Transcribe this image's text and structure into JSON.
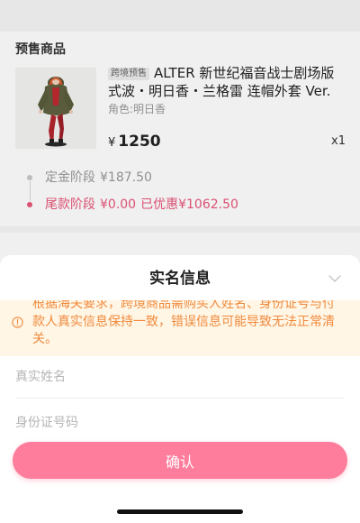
{
  "presale_section": {
    "title": "预售商品"
  },
  "product": {
    "tag": "跨境预售",
    "title": "ALTER 新世纪福音战士剧场版式波・明日香・兰格雷 连帽外套 Ver.",
    "attribute": "角色:明日香",
    "currency": "¥",
    "price": "1250",
    "quantity": "x1"
  },
  "payment_stages": [
    {
      "label": "定金阶段",
      "amount": "¥187.50"
    },
    {
      "label": "尾款阶段",
      "amount": "¥0.00",
      "discount": "已优惠¥1062.50"
    }
  ],
  "real_name_sheet": {
    "title": "实名信息",
    "notice": "根据海关要求，跨境商品需购买人姓名、身份证号与付款人真实信息保持一致，错误信息可能导致无法正常清关。",
    "name_field": {
      "placeholder": "真实姓名",
      "value": ""
    },
    "id_field": {
      "placeholder": "身份证号码",
      "value": ""
    },
    "confirm_label": "确认"
  },
  "icons": {
    "collapse": "chevron-down-icon",
    "notice": "info-circle-icon"
  },
  "colors": {
    "accent_pink": "#fe7c9c",
    "stage_pink": "#e8577a",
    "notice_text": "#f08a3c",
    "notice_background": "#fff6e6"
  }
}
